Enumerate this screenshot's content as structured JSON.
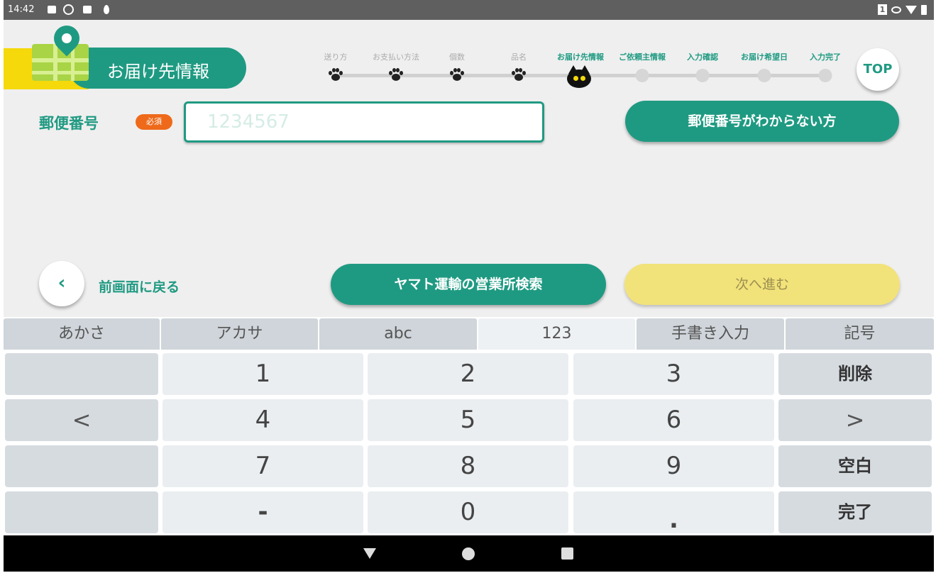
{
  "status_bar": {
    "time": "14:42",
    "sim": "1"
  },
  "header": {
    "title": "お届け先情報"
  },
  "progress": {
    "steps": [
      "送り方",
      "お支払い方法",
      "個数",
      "品名",
      "お届け先情報",
      "ご依頼主情報",
      "入力確認",
      "お届け希望日",
      "入力完了"
    ],
    "current_step": "お届け先情報"
  },
  "top_button": "TOP",
  "postal": {
    "label": "郵便番号",
    "required_badge": "必須",
    "placeholder": "1234567",
    "unknown_button": "郵便番号がわからない方"
  },
  "nav": {
    "back_label": "前画面に戻る",
    "back_icon": "‹",
    "office_search_button": "ヤマト運輸の営業所検索",
    "next_button": "次へ進む"
  },
  "keyboard": {
    "tabs": [
      "あかさ",
      "アカサ",
      "abc",
      "123",
      "手書き入力",
      "記号"
    ],
    "active_tab": "123",
    "keys": {
      "k1": "1",
      "k2": "2",
      "k3": "3",
      "delete": "削除",
      "left": "<",
      "k4": "4",
      "k5": "5",
      "k6": "6",
      "right": ">",
      "k7": "7",
      "k8": "8",
      "k9": "9",
      "space": "空白",
      "minus": "-",
      "k0": "0",
      "dot": ".",
      "done": "完了"
    }
  },
  "colors": {
    "brand": "#1f9a82",
    "accent_yellow": "#f5d90a",
    "next_button": "#f2e27a",
    "required": "#ee6a1a"
  }
}
